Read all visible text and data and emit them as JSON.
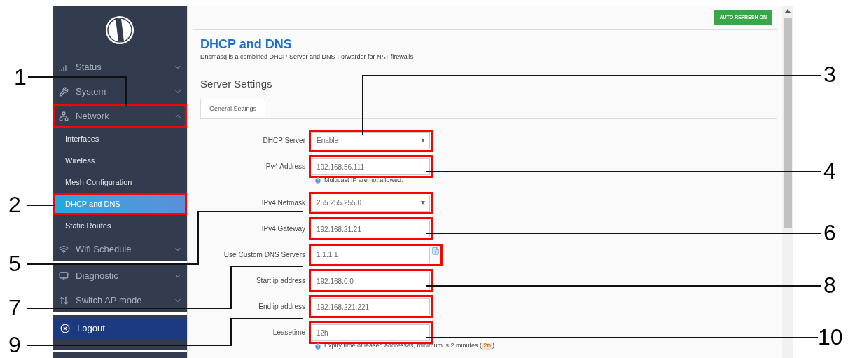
{
  "sidebar": {
    "sections": [
      {
        "items": [
          {
            "kind": "group",
            "label": "Status",
            "expanded": false,
            "highlighted": false
          },
          {
            "kind": "group",
            "label": "System",
            "expanded": false,
            "highlighted": false
          },
          {
            "kind": "group",
            "label": "Network",
            "expanded": true,
            "highlighted": true
          },
          {
            "kind": "sub",
            "label": "Interfaces",
            "selected": false,
            "highlighted": false
          },
          {
            "kind": "sub",
            "label": "Wireless",
            "selected": false,
            "highlighted": false
          },
          {
            "kind": "sub",
            "label": "Mesh Configuration",
            "selected": false,
            "highlighted": false
          },
          {
            "kind": "sub",
            "label": "DHCP and DNS",
            "selected": true,
            "highlighted": true
          },
          {
            "kind": "sub",
            "label": "Static Routes",
            "selected": false,
            "highlighted": false
          },
          {
            "kind": "group",
            "label": "Wifi Schedule",
            "expanded": false,
            "highlighted": false
          }
        ]
      },
      {
        "items": [
          {
            "kind": "group",
            "label": "Diagnostic",
            "expanded": false,
            "highlighted": false
          },
          {
            "kind": "group",
            "label": "Switch AP mode",
            "expanded": false,
            "highlighted": false
          }
        ]
      },
      {
        "items": [
          {
            "kind": "logout",
            "label": "Logout",
            "highlighted": false
          }
        ]
      }
    ]
  },
  "auto_refresh": "AUTO REFRESH ON",
  "page": {
    "title": "DHCP and DNS",
    "description": "Dnsmasq is a combined DHCP-Server and DNS-Forwarder for NAT firewalls"
  },
  "section_title": "Server Settings",
  "tabs": [
    {
      "label": "General Settings",
      "selected": true
    }
  ],
  "fields": [
    {
      "kind": "select",
      "label": "DHCP Server",
      "value": "Enable",
      "highlighted": true
    },
    {
      "kind": "text",
      "label": "IPv4 Address",
      "value": "192.168.56.111",
      "hint": "Multicast IP are not allowed.",
      "highlighted": true
    },
    {
      "kind": "select",
      "label": "IPv4 Netmask",
      "value": "255.255.255.0",
      "highlighted": true
    },
    {
      "kind": "text",
      "label": "IPv4 Gateway",
      "value": "192.168.21.21",
      "highlighted": true
    },
    {
      "kind": "list",
      "label": "Use Custom DNS Servers",
      "value": "1.1.1.1",
      "highlighted": true
    },
    {
      "kind": "text",
      "label": "Start ip address",
      "value": "192.168.0.0",
      "highlighted": true
    },
    {
      "kind": "text",
      "label": "End ip address",
      "value": "192.168.221.221",
      "highlighted": true
    },
    {
      "kind": "text",
      "label": "Leasetime",
      "value": "12h",
      "hint": "Expiry time of leased addresses, minimum is 2 minutes (",
      "hint_code": "2m",
      "hint_after": ").",
      "highlighted": true
    }
  ],
  "callouts": [
    "1",
    "3",
    "4",
    "2",
    "6",
    "5",
    "8",
    "7",
    "9",
    "10"
  ]
}
